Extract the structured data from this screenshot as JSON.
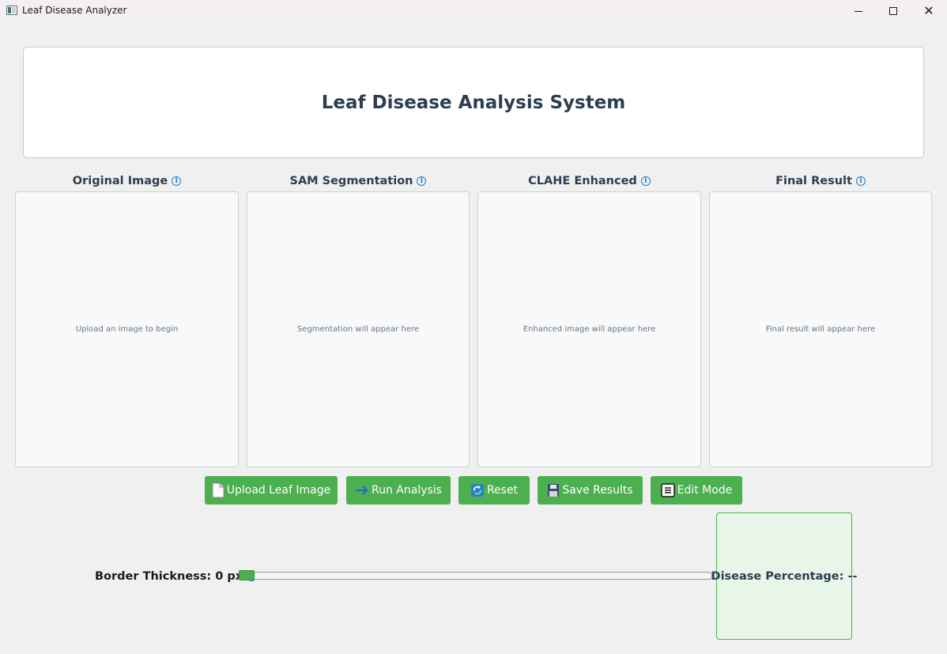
{
  "window": {
    "title": "Leaf Disease Analyzer",
    "minimize_glyph": "",
    "maximize_glyph": "",
    "close_glyph": "✕"
  },
  "header": {
    "title": "Leaf Disease Analysis System"
  },
  "panels": [
    {
      "title": "Original Image",
      "placeholder": "Upload an image to begin"
    },
    {
      "title": "SAM Segmentation",
      "placeholder": "Segmentation will appear here"
    },
    {
      "title": "CLAHE Enhanced",
      "placeholder": "Enhanced image will appear here"
    },
    {
      "title": "Final Result",
      "placeholder": "Final result will appear here"
    }
  ],
  "info_glyph": "i",
  "buttons": {
    "upload": {
      "label": "Upload Leaf Image",
      "icon": "document-icon"
    },
    "run": {
      "label": "Run Analysis",
      "icon": "arrow-right-icon"
    },
    "reset": {
      "label": "Reset",
      "icon": "refresh-icon"
    },
    "save": {
      "label": "Save Results",
      "icon": "floppy-disk-icon"
    },
    "edit": {
      "label": "Edit Mode",
      "icon": "notepad-icon"
    }
  },
  "controls": {
    "border_thickness_label": "Border Thickness: 0 px",
    "border_thickness_value": 0
  },
  "result": {
    "disease_percentage_label": "Disease Percentage: --"
  },
  "colors": {
    "accent_green": "#4caf50",
    "title_text": "#2c3e50",
    "info_blue": "#1a7fd0",
    "result_bg": "#e8f5e9"
  }
}
